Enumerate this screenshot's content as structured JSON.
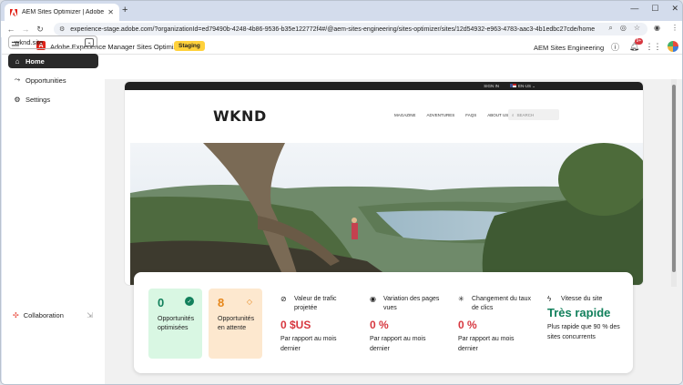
{
  "browser": {
    "tab_title": "AEM Sites Optimizer | Adobe I",
    "url": "experience-stage.adobe.com/?organizationId=ed79490b-4248-4b86-9536-b35e122772f4#/@aem-sites-engineering/sites-optimizer/sites/12d54932-e963-4783-aac3-4b1edbc27cde/home"
  },
  "header": {
    "app_title": "Adobe Experience Manager Sites Optimizer",
    "env_badge": "Staging",
    "org_name": "AEM Sites Engineering",
    "notif_count": "9+"
  },
  "sidebar": {
    "site_selector": "wknd.site",
    "items": [
      {
        "label": "Home"
      },
      {
        "label": "Opportunities"
      },
      {
        "label": "Settings"
      }
    ],
    "collab": "Collaboration"
  },
  "site_preview": {
    "top_signin": "SIGN IN",
    "top_lang": "EN-US",
    "logo": "WKND",
    "nav": [
      "MAGAZINE",
      "ADVENTURES",
      "FAQS",
      "ABOUT US"
    ],
    "search_placeholder": "SEARCH"
  },
  "stats": {
    "optimized": {
      "count": "0",
      "label": "Opportunités optimisées",
      "color": "#d9f7e3"
    },
    "pending": {
      "count": "8",
      "label": "Opportunités en attente",
      "color": "#fde8cf"
    },
    "metrics": [
      {
        "title": "Valeur de trafic projetée",
        "value": "0 $US",
        "sub": "Par rapport au mois dernier"
      },
      {
        "title": "Variation des pages vues",
        "value": "0 %",
        "sub": "Par rapport au mois dernier"
      },
      {
        "title": "Changement du taux de clics",
        "value": "0 %",
        "sub": "Par rapport au mois dernier"
      },
      {
        "title": "Vitesse du site",
        "value": "Très rapide",
        "sub": "Plus rapide que 90 % des sites concurrents"
      }
    ]
  }
}
